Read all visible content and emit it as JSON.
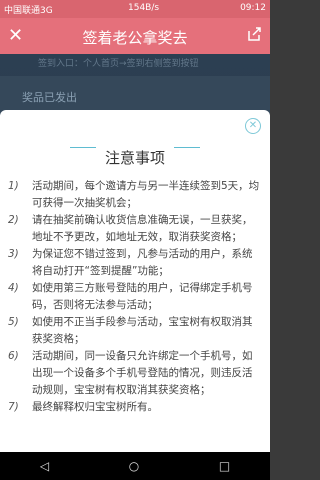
{
  "status_bar": {
    "carrier": "中国联通3G",
    "speed": "154B/s",
    "time": "09:12"
  },
  "header": {
    "title": "签着老公拿奖去"
  },
  "background": {
    "line": "签到入口：个人首页→签到右侧签到按钮",
    "prize_status": "奖品已发出"
  },
  "modal": {
    "title": "注意事项",
    "rules": [
      {
        "num": "1)",
        "text": "活动期间，每个邀请方与另一半连续签到5天，均可获得一次抽奖机会；"
      },
      {
        "num": "2)",
        "text": "请在抽奖前确认收货信息准确无误，一旦获奖，地址不予更改，如地址无效，取消获奖资格；"
      },
      {
        "num": "3)",
        "text": "为保证您不错过签到，凡参与活动的用户，系统将自动打开“签到提醒”功能；"
      },
      {
        "num": "4)",
        "text": "如使用第三方账号登陆的用户，记得绑定手机号码，否则将无法参与活动；"
      },
      {
        "num": "5)",
        "text": "如使用不正当手段参与活动，宝宝树有权取消其获奖资格；"
      },
      {
        "num": "6)",
        "text": "活动期间，同一设备只允许绑定一个手机号，如出现一个设备多个手机号登陆的情况，则违反活动规则，宝宝树有权取消其获奖资格；"
      },
      {
        "num": "7)",
        "text": "最终解释权归宝宝树所有。"
      }
    ]
  },
  "icons": {
    "close": "close-icon",
    "share": "share-icon",
    "modal_close": "close-circle-icon"
  }
}
